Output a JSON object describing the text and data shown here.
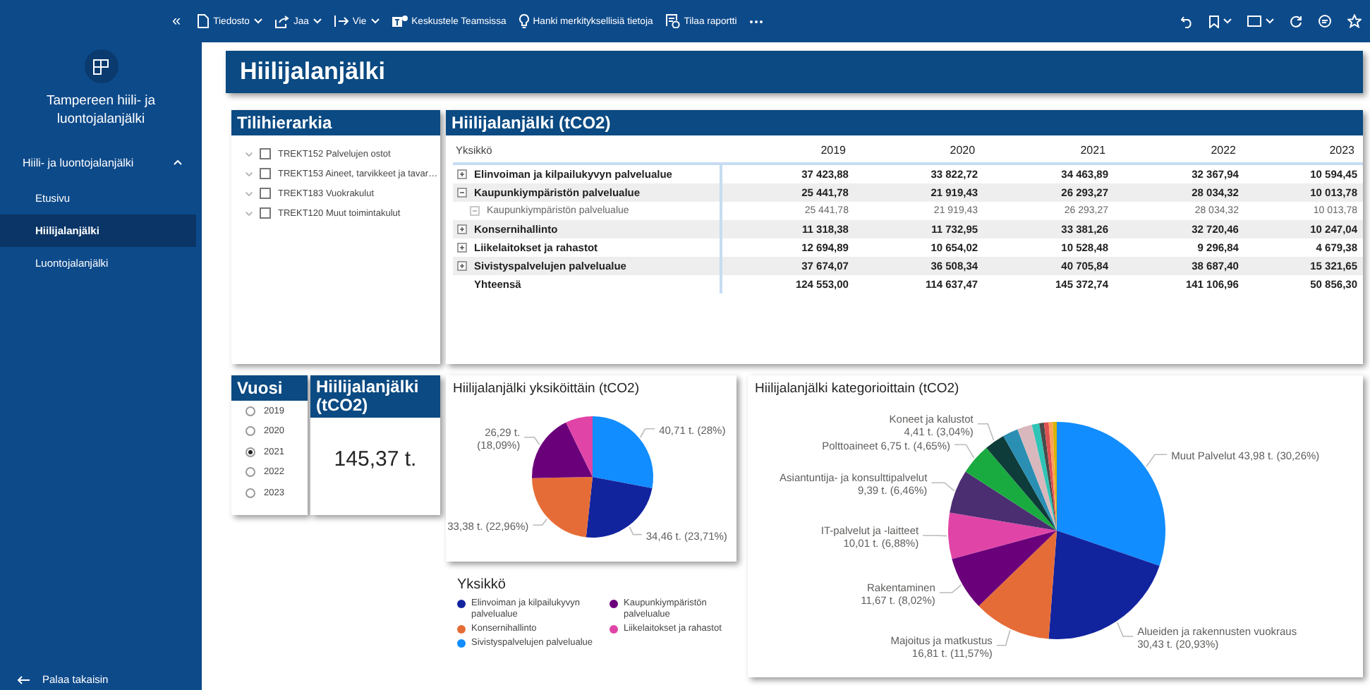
{
  "topbar": {
    "collapse": "«",
    "items": [
      {
        "label": "Tiedosto",
        "dropdown": true
      },
      {
        "label": "Jaa",
        "dropdown": true
      },
      {
        "label": "Vie",
        "dropdown": true
      },
      {
        "label": "Keskustele Teamsissa",
        "dropdown": false
      },
      {
        "label": "Hanki merkityksellisiä tietoja",
        "dropdown": false
      },
      {
        "label": "Tilaa raportti",
        "dropdown": false
      }
    ]
  },
  "sidebar": {
    "title": "Tampereen hiili- ja luontojalanjälki",
    "section": {
      "label": "Hiili- ja luontojalanjälki",
      "expanded": true,
      "items": [
        {
          "label": "Etusivu",
          "selected": false
        },
        {
          "label": "Hiilijalanjälki",
          "selected": true
        },
        {
          "label": "Luontojalanjälki",
          "selected": false
        }
      ]
    },
    "back": "Palaa takaisin"
  },
  "page_title": "Hiilijalanjälki",
  "hierarchy": {
    "title": "Tilihierarkia",
    "items": [
      {
        "label": "TREKT152 Palvelujen ostot",
        "checked": false
      },
      {
        "label": "TREKT153 Aineet, tarvikkeet ja tavar…",
        "checked": false
      },
      {
        "label": "TREKT183 Vuokrakulut",
        "checked": false
      },
      {
        "label": "TREKT120 Muut toimintakulut",
        "checked": false
      }
    ]
  },
  "matrix": {
    "title": "Hiilijalanjälki (tCO2)",
    "columns": [
      "Yksikkö",
      "2019",
      "2020",
      "2021",
      "2022",
      "2023"
    ],
    "rows": [
      {
        "label": "Elinvoiman ja kilpailukyvyn palvelualue",
        "expanded": false,
        "values": [
          "37 423,88",
          "33 822,72",
          "34 463,89",
          "32 367,94",
          "10 594,45"
        ]
      },
      {
        "label": "Kaupunkiympäristön palvelualue",
        "expanded": true,
        "values": [
          "25 441,78",
          "21 919,43",
          "26 293,27",
          "28 034,32",
          "10 013,78"
        ],
        "children": [
          {
            "label": "Kaupunkiympäristön palvelualue",
            "values": [
              "25 441,78",
              "21 919,43",
              "26 293,27",
              "28 034,32",
              "10 013,78"
            ]
          }
        ]
      },
      {
        "label": "Konsernihallinto",
        "expanded": false,
        "values": [
          "11 318,38",
          "11 732,95",
          "33 381,26",
          "32 720,46",
          "10 247,04"
        ]
      },
      {
        "label": "Liikelaitokset ja rahastot",
        "expanded": false,
        "values": [
          "12 694,89",
          "10 654,02",
          "10 528,48",
          "9 296,84",
          "4 679,38"
        ]
      },
      {
        "label": "Sivistyspalvelujen palvelualue",
        "expanded": false,
        "values": [
          "37 674,07",
          "36 508,34",
          "40 705,84",
          "38 687,40",
          "15 321,65"
        ]
      }
    ],
    "total": {
      "label": "Yhteensä",
      "values": [
        "124 553,00",
        "114 637,47",
        "145 372,74",
        "141 106,96",
        "50 856,30"
      ]
    }
  },
  "year_slicer": {
    "title": "Vuosi",
    "options": [
      {
        "label": "2019",
        "selected": false
      },
      {
        "label": "2020",
        "selected": false
      },
      {
        "label": "2021",
        "selected": true
      },
      {
        "label": "2022",
        "selected": false
      },
      {
        "label": "2023",
        "selected": false
      }
    ]
  },
  "kpi_card": {
    "title": "Hiilijalanjälki (tCO2)",
    "value": "145,37 t."
  },
  "unit_pie": {
    "chart_data": {
      "type": "pie",
      "title": "Hiilijalanjälki yksiköittäin (tCO2)",
      "categories": [
        "Elinvoiman ja kilpailukyvyn palvelualue",
        "Kaupunkiympäristön palvelualue",
        "Konsernihallinto",
        "Liikelaitokset ja rahastot",
        "Sivistyspalvelujen palvelualue"
      ],
      "values": [
        23.71,
        18.09,
        22.96,
        7.24,
        28
      ],
      "colors": [
        "#12239e",
        "#6b007b",
        "#e66c37",
        "#e044a7",
        "#118dff"
      ],
      "value_labels": [
        "34,46 t. (23,71%)",
        "26,29 t. (18,09%)",
        "33,38 t. (22,96%)",
        null,
        "40,71 t. (28%)"
      ]
    }
  },
  "legend": {
    "title": "Yksikkö"
  },
  "category_pie": {
    "chart_data": {
      "type": "pie",
      "title": "Hiilijalanjälki kategorioittain (tCO2)",
      "categories": [
        "Muut Palvelut",
        "Alueiden ja rakennusten vuokraus",
        "Majoitus ja matkustus",
        "Rakentaminen",
        "IT-palvelut ja -laitteet",
        "Asiantuntija- ja konsulttipalvelut",
        "Polttoaineet",
        "Koneet ja kalustot",
        null,
        null,
        null,
        null,
        null,
        null,
        null
      ],
      "values": [
        30.26,
        20.93,
        11.57,
        8.02,
        6.88,
        6.46,
        4.65,
        3.04,
        2.3,
        2.2,
        1.1,
        0.7,
        0.7,
        0.6,
        0.59
      ],
      "colors": [
        "#118dff",
        "#12239e",
        "#e66c37",
        "#6b007b",
        "#e044a7",
        "#4b2d72",
        "#1aab40",
        "#0e3c3a",
        "#2a8fb3",
        "#d9b8bd",
        "#2ec4b6",
        "#4a4a4a",
        "#e05050",
        "#ffa058",
        "#d9b300"
      ],
      "value_labels": [
        "43,98 t. (30,26%)",
        "30,43 t. (20,93%)",
        "16,81 t. (11,57%)",
        "11,67 t. (8,02%)",
        "10,01 t. (6,88%)",
        "9,39 t. (6,46%)",
        "6,75 t. (4,65%)",
        "4,41 t. (3,04%)",
        null,
        null,
        null,
        null,
        null,
        null,
        null
      ]
    }
  }
}
